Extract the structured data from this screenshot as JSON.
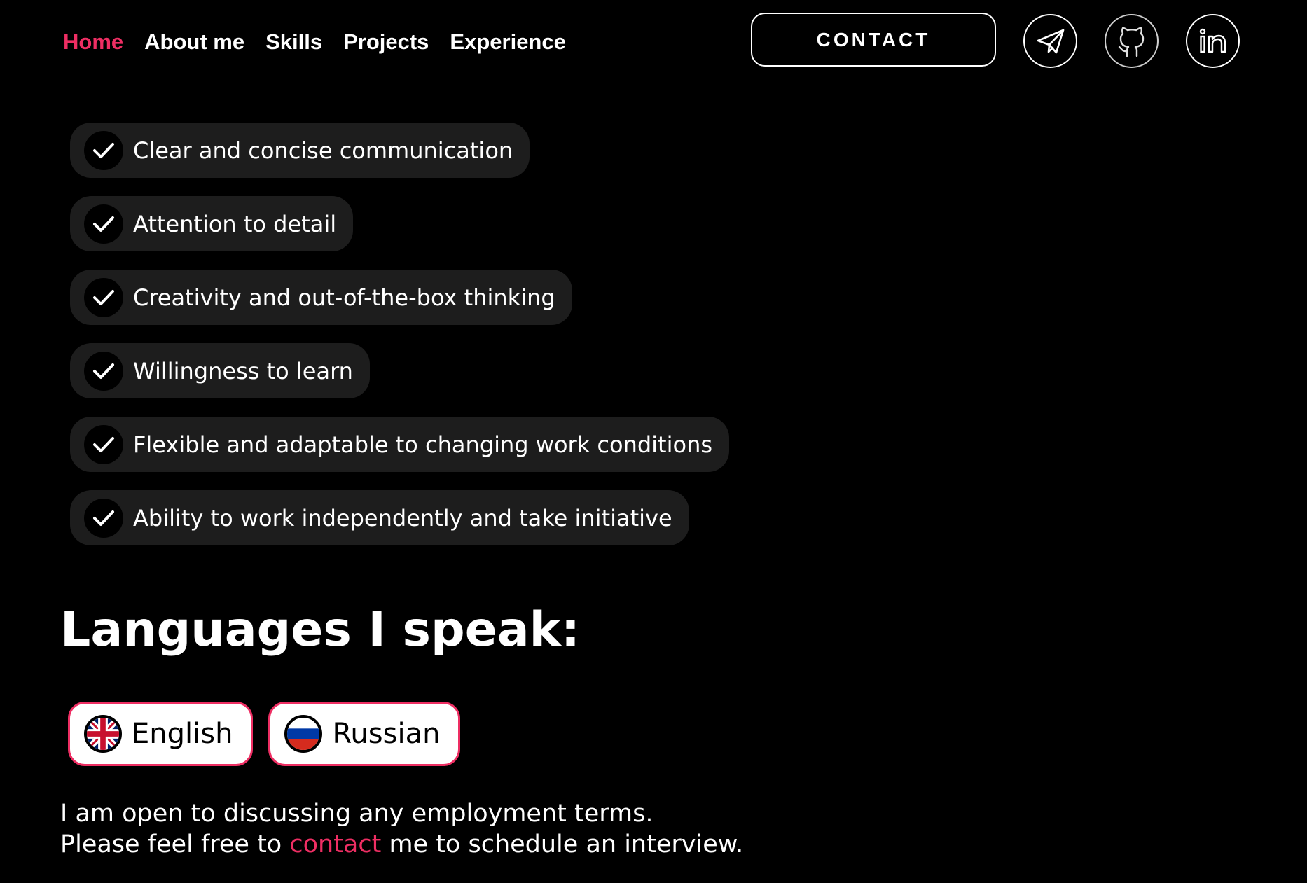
{
  "nav": {
    "items": [
      {
        "label": "Home",
        "active": true
      },
      {
        "label": "About me",
        "active": false
      },
      {
        "label": "Skills",
        "active": false
      },
      {
        "label": "Projects",
        "active": false
      },
      {
        "label": "Experience",
        "active": false
      }
    ],
    "contact_label": "CONTACT",
    "social_icons": [
      "telegram-icon",
      "github-icon",
      "linkedin-icon"
    ]
  },
  "soft_skills": {
    "items": [
      "Clear and concise communication",
      "Attention to detail",
      "Creativity and out-of-the-box thinking",
      "Willingness to learn",
      "Flexible and adaptable to changing work conditions",
      "Ability to work independently and take initiative"
    ]
  },
  "languages": {
    "title": "Languages I speak:",
    "items": [
      {
        "label": "English",
        "flag": "uk-flag-icon"
      },
      {
        "label": "Russian",
        "flag": "russia-flag-icon"
      }
    ]
  },
  "outro": {
    "line1": "I am open to discussing any employment terms.",
    "line2_before": "Please feel free to ",
    "line2_link": "contact",
    "line2_after": " me to schedule an interview."
  },
  "colors": {
    "accent": "#ee2e63",
    "background": "#000000",
    "pill": "#1d1d1d"
  }
}
